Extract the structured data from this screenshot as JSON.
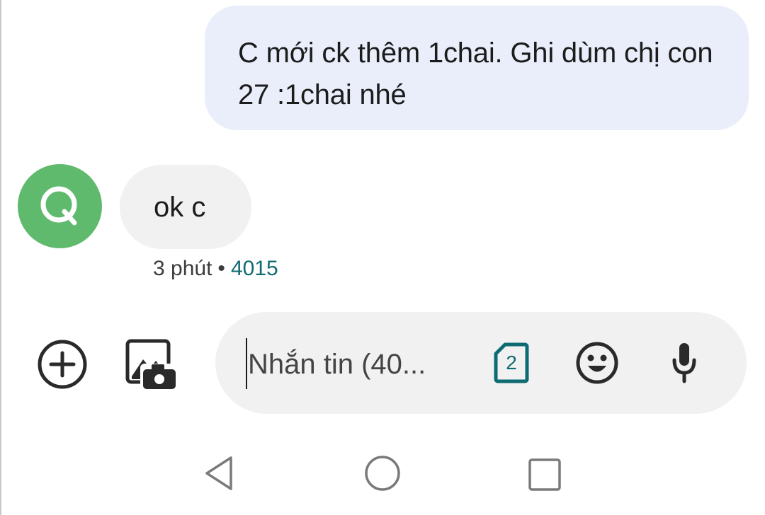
{
  "conversation": {
    "outgoing_message": "C mới ck thêm 1chai. Ghi dùm chị con 27 :1chai nhé",
    "incoming": {
      "avatar_letter": "Q",
      "message": "ok c",
      "time": "3 phút",
      "separator": "•",
      "sim_label": "4015"
    }
  },
  "composer": {
    "placeholder": "Nhắn tin (40...",
    "sim_slot": "2"
  },
  "icons": {
    "attach": "add-circle-icon",
    "gallery": "gallery-camera-icon",
    "sim": "sim-card-icon",
    "emoji": "emoji-icon",
    "voice": "microphone-icon",
    "back": "back-triangle-icon",
    "home": "home-circle-icon",
    "recents": "recents-square-icon"
  },
  "colors": {
    "outgoing_bubble": "#e9eefa",
    "incoming_bubble": "#f1f1f1",
    "avatar": "#5fba6e",
    "sim_accent": "#0f6b72"
  }
}
